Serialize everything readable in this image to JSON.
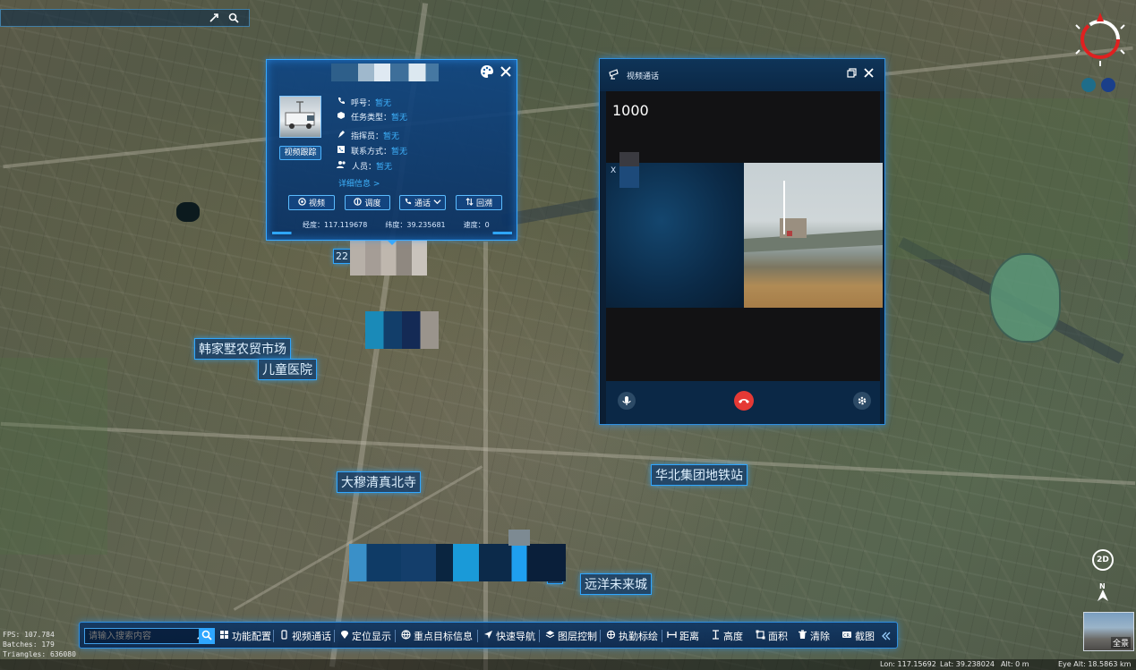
{
  "top_search": {
    "placeholder": "",
    "pin_icon": "pin-icon",
    "search_icon": "search-icon"
  },
  "map_labels": [
    {
      "id": "hanjiashu",
      "text": "韩家墅农贸市场"
    },
    {
      "id": "children-hospital",
      "text": "儿童医院"
    },
    {
      "id": "mosque",
      "text": "大穆清真北寺"
    },
    {
      "id": "huabei-metro",
      "text": "华北集团地铁站"
    },
    {
      "id": "yuanyang",
      "text": "远洋未来城"
    },
    {
      "id": "label-22",
      "text": "22"
    },
    {
      "id": "label-chang",
      "text": "场"
    }
  ],
  "info_popup": {
    "palette_icon": "palette-icon",
    "close_icon": "close-icon",
    "track_button": "视频跟踪",
    "rows": [
      {
        "label": "呼号：",
        "value": "暂无",
        "icon": "phone-icon"
      },
      {
        "label": "任务类型：",
        "value": "暂无",
        "icon": "cube-icon"
      },
      {
        "label": "指挥员：",
        "value": "暂无",
        "icon": "commander-icon"
      },
      {
        "label": "联系方式：",
        "value": "暂无",
        "icon": "contact-icon"
      },
      {
        "label": "人员：",
        "value": "暂无",
        "icon": "people-icon"
      }
    ],
    "detail_link": "详细信息 >",
    "actions": [
      {
        "label": "视频",
        "icon": "video-icon"
      },
      {
        "label": "调度",
        "icon": "dispatch-icon"
      },
      {
        "label": "通话",
        "icon": "call-icon"
      },
      {
        "label": "回溯",
        "icon": "replay-icon"
      }
    ],
    "footer": {
      "lon": "经度：117.119678",
      "lat": "纬度：39.235681",
      "speed": "速度：0"
    }
  },
  "video_call": {
    "title": "视频通话",
    "number": "1000",
    "xx_label": "X",
    "restore_icon": "restore-icon",
    "close_icon": "close-icon",
    "mic_icon": "mic-icon",
    "hangup_icon": "hangup-icon",
    "settings_icon": "settings-icon"
  },
  "toolbar": {
    "search_placeholder": "请输入搜索内容",
    "items": [
      {
        "label": "功能配置",
        "icon": "grid-icon"
      },
      {
        "label": "视频通话",
        "icon": "video-call-icon"
      },
      {
        "label": "定位显示",
        "icon": "location-icon"
      },
      {
        "label": "重点目标信息",
        "icon": "globe-icon"
      },
      {
        "label": "快速导航",
        "icon": "navigate-icon"
      },
      {
        "label": "图层控制",
        "icon": "layers-icon"
      },
      {
        "label": "执勤标绘",
        "icon": "plot-icon"
      },
      {
        "label": "距离",
        "icon": "distance-icon"
      },
      {
        "label": "高度",
        "icon": "height-icon"
      },
      {
        "label": "面积",
        "icon": "area-icon"
      },
      {
        "label": "清除",
        "icon": "trash-icon"
      },
      {
        "label": "截图",
        "icon": "screenshot-icon"
      }
    ],
    "collapse_icon": "collapse-icon"
  },
  "stats": {
    "fps": "FPS: 107.784",
    "batches": "Batches: 179",
    "triangles": "Triangles: 636080"
  },
  "status_bar": {
    "lon": "Lon: 117.15692",
    "lat": "Lat: 39.238024",
    "alt": "Alt: 0 m",
    "eye": "Eye Alt: 18.5863 km"
  },
  "right_controls": {
    "mode_2d": "2D",
    "overview_label": "全景"
  },
  "colors": {
    "accent": "#2ea6ff",
    "panel_bg": "#0f3458",
    "value_blue": "#3fb4ff",
    "hangup_red": "#e53935"
  }
}
